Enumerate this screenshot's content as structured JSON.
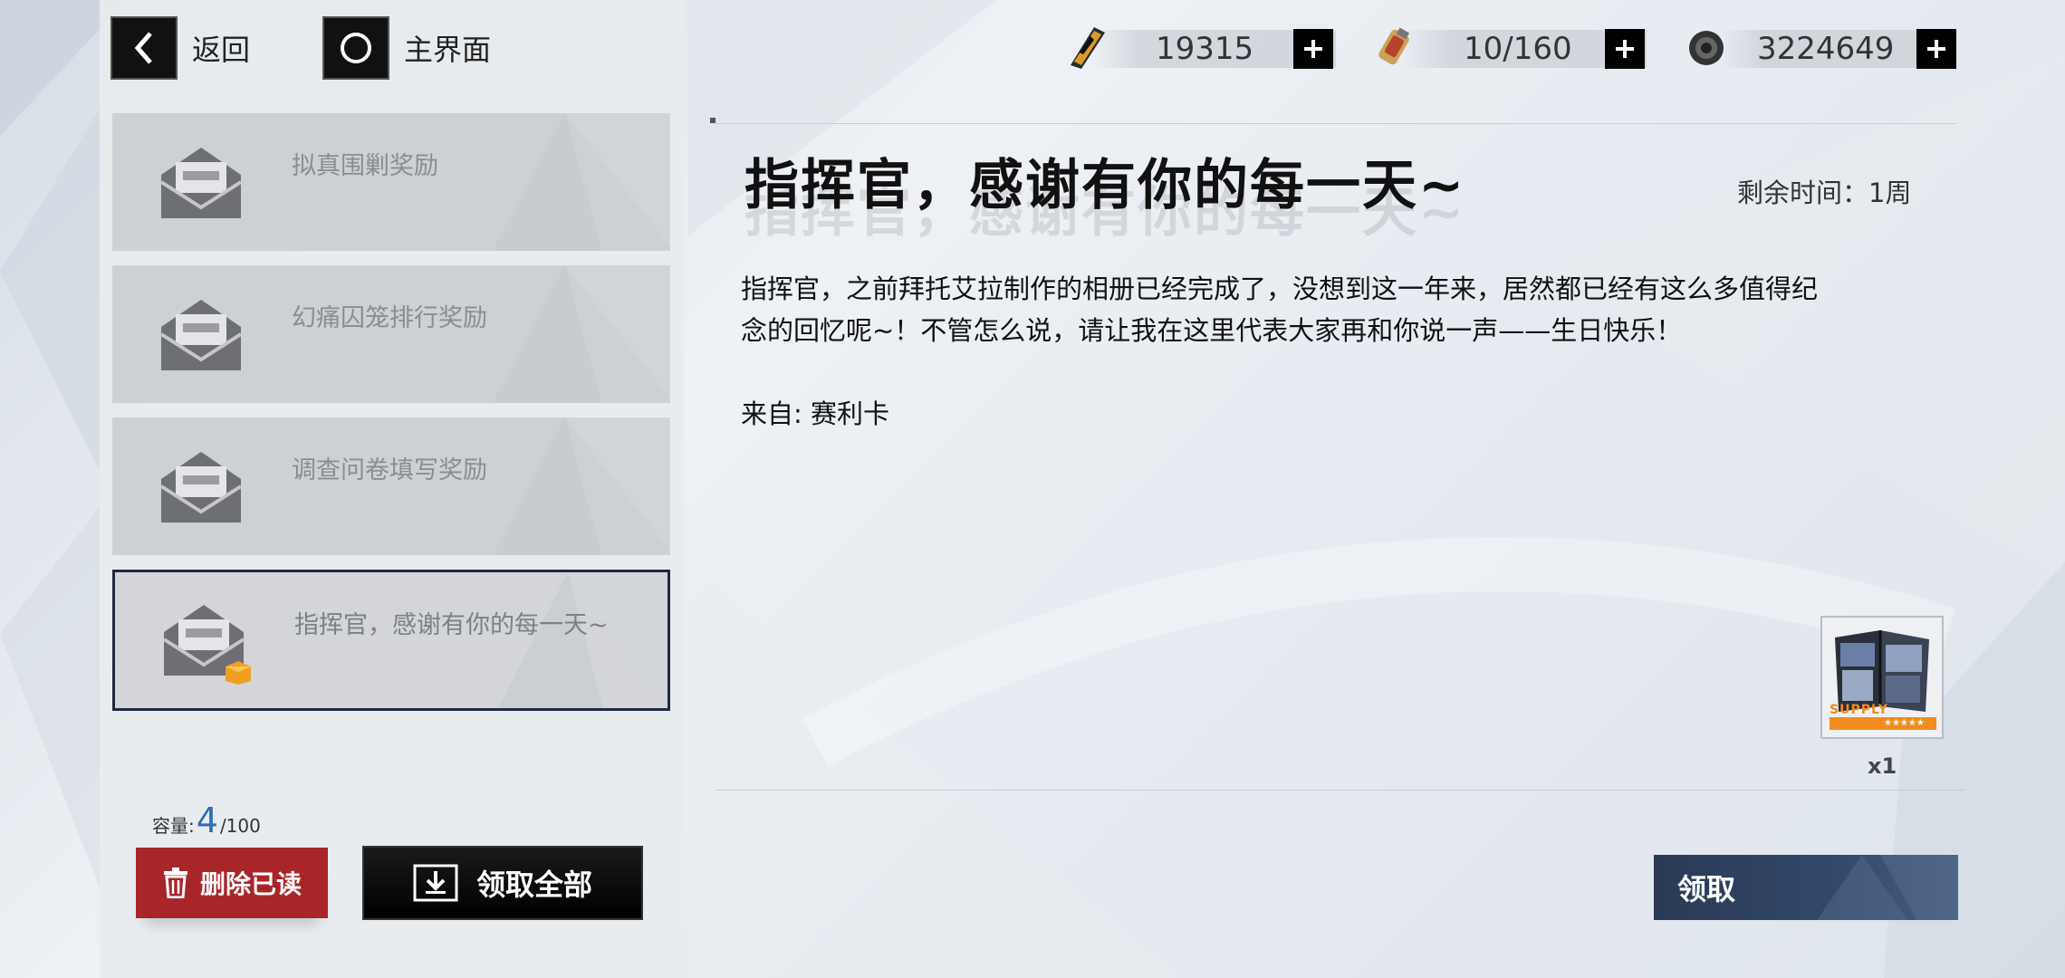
{
  "nav": {
    "back_label": "返回",
    "home_label": "主界面"
  },
  "resources": [
    {
      "icon": "battery-ticket-icon",
      "value": "19315"
    },
    {
      "icon": "energy-canister-icon",
      "value": "10/160"
    },
    {
      "icon": "gear-coin-icon",
      "value": "3224649"
    }
  ],
  "mail_list": [
    {
      "title": "拟真围剿奖励"
    },
    {
      "title": "幻痛囚笼排行奖励"
    },
    {
      "title": "调查问卷填写奖励"
    },
    {
      "title": "指挥官，感谢有你的每一天~",
      "selected": true
    }
  ],
  "capacity": {
    "label": "容量:",
    "current": "4",
    "max": "/100"
  },
  "buttons": {
    "delete_read": "删除已读",
    "claim_all": "领取全部",
    "claim": "领取"
  },
  "mail": {
    "title": "指挥官，感谢有你的每一天~",
    "remaining": "剩余时间：1周",
    "body_line1": "指挥官，之前拜托艾拉制作的相册已经完成了，没想到这一年来，居然都已经有这么多值得纪",
    "body_line2": "念的回忆呢~！不管怎么说，请让我在这里代表大家再和你说一声——生日快乐！",
    "from": "来自: 赛利卡"
  },
  "reward": {
    "label": "SUPPLY",
    "stars": "★★★★★",
    "count": "x1"
  }
}
